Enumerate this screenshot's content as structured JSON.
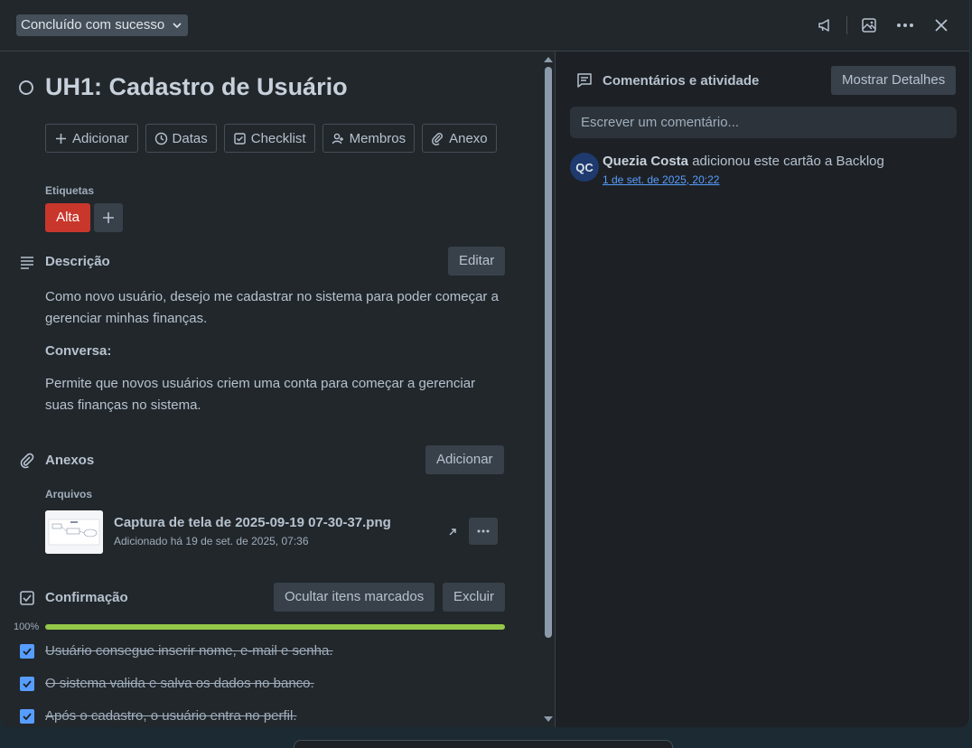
{
  "header": {
    "status_label": "Concluído com sucesso"
  },
  "card": {
    "title": "UH1: Cadastro de Usuário"
  },
  "actions": [
    {
      "label": "Adicionar",
      "icon": "plus-icon"
    },
    {
      "label": "Datas",
      "icon": "clock-icon"
    },
    {
      "label": "Checklist",
      "icon": "checklist-icon"
    },
    {
      "label": "Membros",
      "icon": "members-icon"
    },
    {
      "label": "Anexo",
      "icon": "paperclip-icon"
    }
  ],
  "labels": {
    "heading": "Etiquetas",
    "items": [
      {
        "text": "Alta",
        "color": "#c9372c"
      }
    ]
  },
  "description": {
    "title": "Descrição",
    "edit_label": "Editar",
    "paragraph1": "Como novo usuário, desejo me cadastrar no sistema para poder começar a gerenciar minhas finanças.",
    "conversa_label": "Conversa:",
    "paragraph2": "Permite que novos usuários criem uma conta para começar a gerenciar suas finanças no sistema."
  },
  "attachments": {
    "title": "Anexos",
    "add_label": "Adicionar",
    "files_heading": "Arquivos",
    "file": {
      "name": "Captura de tela de 2025-09-19 07-30-37.png",
      "meta": "Adicionado há 19 de set. de 2025, 07:36"
    }
  },
  "checklist": {
    "title": "Confirmação",
    "hide_label": "Ocultar itens marcados",
    "delete_label": "Excluir",
    "percent_label": "100%",
    "progress": 1.0,
    "items": [
      {
        "text": "Usuário consegue inserir nome, e-mail e senha.",
        "checked": true
      },
      {
        "text": "O sistema valida e salva os dados no banco.",
        "checked": true
      },
      {
        "text": "Após o cadastro, o usuário entra no perfil.",
        "checked": true
      }
    ]
  },
  "activity": {
    "title": "Comentários e atividade",
    "details_label": "Mostrar Detalhes",
    "comment_placeholder": "Escrever um comentário...",
    "entries": [
      {
        "initials": "QC",
        "user": "Quezia Costa",
        "text": "adicionou este cartão a Backlog",
        "time": "1 de set. de 2025, 20:22"
      }
    ]
  },
  "colors": {
    "accent": "#579dff",
    "progress": "#94c748",
    "label_red": "#c9372c"
  }
}
